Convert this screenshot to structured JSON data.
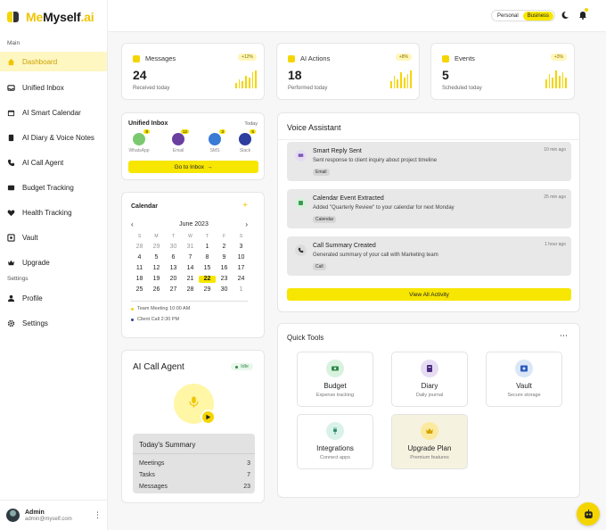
{
  "brand": {
    "name_part1": "Me",
    "name_part2": "Myself",
    "name_part3": ".ai"
  },
  "sidebar": {
    "section_main": "Main",
    "section_settings": "Settings",
    "items": [
      {
        "label": "Dashboard",
        "icon": "home-icon"
      },
      {
        "label": "Unified Inbox",
        "icon": "inbox-icon"
      },
      {
        "label": "AI Smart Calendar",
        "icon": "calendar-icon"
      },
      {
        "label": "AI Diary & Voice Notes",
        "icon": "book-icon"
      },
      {
        "label": "AI Call Agent",
        "icon": "phone-icon"
      },
      {
        "label": "Budget Tracking",
        "icon": "wallet-icon"
      },
      {
        "label": "Health Tracking",
        "icon": "heart-icon"
      },
      {
        "label": "Vault",
        "icon": "vault-icon"
      },
      {
        "label": "Upgrade",
        "icon": "crown-icon"
      },
      {
        "label": "Profile",
        "icon": "user-icon"
      },
      {
        "label": "Settings",
        "icon": "gear-icon"
      }
    ],
    "user": {
      "name": "Admin",
      "email": "admin@myself.com"
    }
  },
  "topbar": {
    "mode_personal": "Personal",
    "mode_business": "Business"
  },
  "stats": [
    {
      "label": "Messages",
      "badge": "+12%",
      "value": "24",
      "sub": "Received today"
    },
    {
      "label": "AI Actions",
      "badge": "+8%",
      "value": "18",
      "sub": "Performed today"
    },
    {
      "label": "Events",
      "badge": "+3%",
      "value": "5",
      "sub": "Scheduled today"
    }
  ],
  "inbox": {
    "title": "Unified Inbox",
    "period": "Today",
    "channels": [
      {
        "label": "WhatsApp",
        "count": "8",
        "color": "#5cb85c"
      },
      {
        "label": "Email",
        "count": "12",
        "color": "#6a3fa0"
      },
      {
        "label": "SMS",
        "count": "3",
        "color": "#3a7bd5"
      },
      {
        "label": "Slack",
        "count": "5",
        "color": "#2c3e9e"
      }
    ],
    "button": "Go to Inbox"
  },
  "calendar": {
    "title": "Calendar",
    "month": "June 2023",
    "weekdays": [
      "S",
      "M",
      "T",
      "W",
      "T",
      "F",
      "S"
    ],
    "days": [
      "28",
      "29",
      "30",
      "31",
      "1",
      "2",
      "3",
      "4",
      "5",
      "6",
      "7",
      "8",
      "9",
      "10",
      "11",
      "12",
      "13",
      "14",
      "15",
      "16",
      "17",
      "18",
      "19",
      "20",
      "21",
      "22",
      "23",
      "24",
      "25",
      "26",
      "27",
      "28",
      "29",
      "30",
      "1"
    ],
    "muted_first": 4,
    "today_index": 25,
    "events": [
      {
        "text": "Team Meeting 10:00 AM",
        "color": "#f5d500"
      },
      {
        "text": "Client Call 2:30 PM",
        "color": "#2c3e9e"
      }
    ]
  },
  "voice": {
    "title": "Voice Assistant",
    "items": [
      {
        "title": "Smart Reply Sent",
        "desc": "Sent response to client inquiry about project timeline",
        "tag": "Email",
        "time": "10 min ago"
      },
      {
        "title": "Calendar Event Extracted",
        "desc": "Added \"Quarterly Review\" to your calendar for next Monday",
        "tag": "Calendar",
        "time": "25 min ago"
      },
      {
        "title": "Call Summary Created",
        "desc": "Generated summary of your call with Marketing team",
        "tag": "Call",
        "time": "1 hour ago"
      }
    ],
    "button": "View All Activity"
  },
  "call_agent": {
    "title": "AI Call Agent",
    "status": "Idle",
    "summary_title": "Today's Summary",
    "rows": [
      {
        "label": "Meetings",
        "value": "3"
      },
      {
        "label": "Tasks",
        "value": "7"
      },
      {
        "label": "Messages",
        "value": "23"
      }
    ]
  },
  "tools": {
    "title": "Quick Tools",
    "items": [
      {
        "name": "Budget",
        "desc": "Expense tracking"
      },
      {
        "name": "Diary",
        "desc": "Daily journal"
      },
      {
        "name": "Vault",
        "desc": "Secure storage"
      },
      {
        "name": "Integrations",
        "desc": "Connect apps"
      },
      {
        "name": "Upgrade Plan",
        "desc": "Premium features"
      }
    ]
  },
  "colors": {
    "accent": "#f5d500",
    "active_bg": "#fff7c2"
  }
}
